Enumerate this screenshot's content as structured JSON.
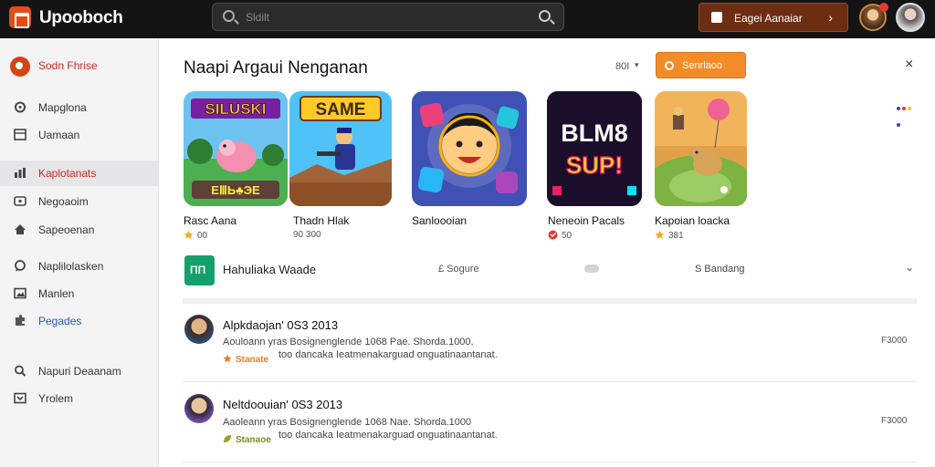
{
  "topbar": {
    "app_title": "Upooboch",
    "search_placeholder": "Sldilt",
    "cta_label": "Eagei Aanaiar",
    "cta_chevron": "›"
  },
  "sidebar": {
    "items": [
      {
        "label": "Sodn Fhrise",
        "icon": "brand-icon",
        "style": "red"
      },
      {
        "label": "Mapglona",
        "icon": "gamepad-icon"
      },
      {
        "label": "Uamaan",
        "icon": "grid-icon"
      },
      {
        "label": "Kaplotanats",
        "icon": "chart-icon",
        "style": "red",
        "active": true
      },
      {
        "label": "Negoaoim",
        "icon": "message-icon"
      },
      {
        "label": "Sapeoenan",
        "icon": "home-icon"
      },
      {
        "label": "Naplilolasken",
        "icon": "chat-icon"
      },
      {
        "label": "Manlen",
        "icon": "image-icon"
      },
      {
        "label": "Pegades",
        "icon": "puzzle-icon",
        "style": "blue"
      },
      {
        "label": "Napuri Deaanam",
        "icon": "search-icon"
      },
      {
        "label": "Yrolem",
        "icon": "window-icon"
      }
    ]
  },
  "main": {
    "title": "Naapi Argaui Nenganan",
    "sort_label": "80I",
    "sort_chevron": "▾",
    "action_label": "Senrlaoo",
    "close_label": "×",
    "more_colors": [
      "#3949ab",
      "#e53935",
      "#fbc02d",
      "#3949ab"
    ],
    "games": [
      {
        "name": "Rasc Aana",
        "meta": "00",
        "art_text": "SILUSKI",
        "art_sub": "ЕⅢЬ♣ЭЕ",
        "badge_color": "#f9a825",
        "badge_icon": "stars-icon"
      },
      {
        "name": "Thadn Hlak",
        "meta": "90 300",
        "art_text": "SAME",
        "badge_color": "",
        "badge_icon": ""
      },
      {
        "name": "Sanloooian",
        "meta": "",
        "art_text": "",
        "badge_color": "",
        "badge_icon": ""
      },
      {
        "name": "Neneoin Pacals",
        "meta": "50",
        "art_text": "BLM8 SUP!",
        "badge_color": "#e53935",
        "badge_icon": "heart-icon"
      },
      {
        "name": "Kapoian loacka",
        "meta": "381",
        "art_text": "",
        "badge_color": "#f9a825",
        "badge_icon": "stars-icon"
      }
    ],
    "strip": {
      "title": "Hahuliaka Waade",
      "meta1": "£ Sogure",
      "meta2": "S Bandang",
      "chevron": "⌄"
    },
    "comments": [
      {
        "author": "Alpkdaojan' 0S3 2013",
        "line1": "Aouloann yras Bosignenglende 1068 Pae. Shorda.1000.",
        "line2": "too dancaka  Ieatmenakarguad onguatinaantanat.",
        "tag": "Stanate",
        "tag_color": "#e67e22",
        "side": "F3000"
      },
      {
        "author": "Neltdoouian' 0S3 2013",
        "line1": "Aaoleann yras Bosignenglende 1068 Nae. Shorda.1000",
        "line2": "too dancaka  Ieatmenakarguad onguatinaantanat.",
        "tag": "Stanaoe",
        "tag_color": "#7c8a1f",
        "side": "F3000"
      }
    ]
  }
}
